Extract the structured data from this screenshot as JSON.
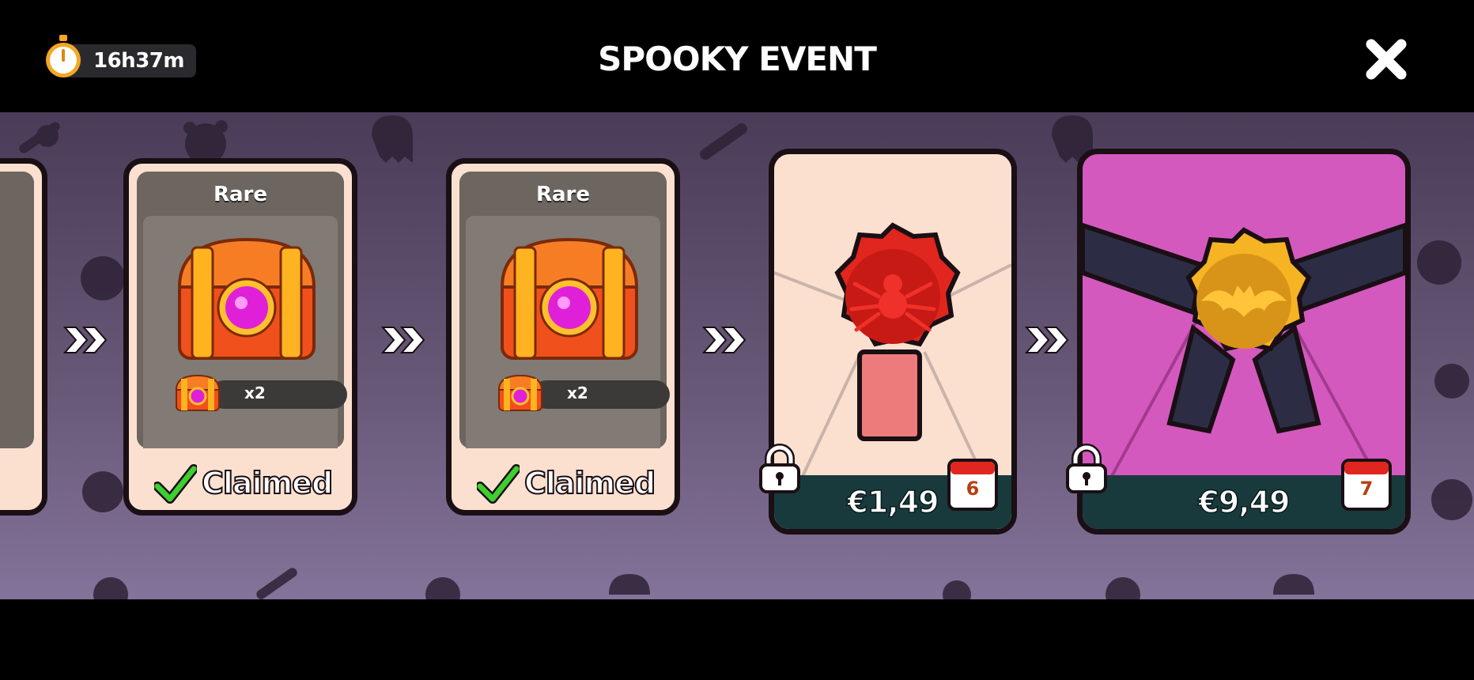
{
  "header": {
    "timer": "16h37m",
    "title": "SPOOKY EVENT",
    "icons": {
      "timer": "stopwatch-icon",
      "close": "close-icon"
    }
  },
  "rewards": [
    {
      "rarity": "Rare",
      "quantity": "x2",
      "status": "Claimed",
      "icon": "chest-icon"
    },
    {
      "rarity": "Rare",
      "quantity": "x2",
      "status": "Claimed",
      "icon": "chest-icon"
    }
  ],
  "offers": [
    {
      "price": "€1,49",
      "day": "6",
      "icon": "spider-wax-seal-icon",
      "locked": true
    },
    {
      "price": "€9,49",
      "day": "7",
      "icon": "bat-wax-seal-icon",
      "locked": true
    }
  ],
  "colors": {
    "background": "#000000",
    "stage": "#5e4f6e",
    "card": "#fbe0d0",
    "offer_premium": "#d459be",
    "price_footer": "#183a3c",
    "claimed_check": "#2fbf2a"
  }
}
